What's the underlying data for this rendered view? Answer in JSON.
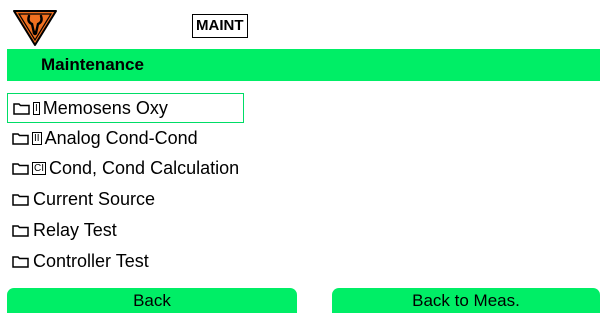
{
  "header": {
    "maint_tag": "MAINT",
    "icon": "maintenance-wrench-warning-icon"
  },
  "title": "Maintenance",
  "menu": {
    "items": [
      {
        "label": "Memosens Oxy",
        "channel": "I",
        "selected": true
      },
      {
        "label": "Analog Cond-Cond",
        "channel": "II",
        "selected": false
      },
      {
        "label": "Cond, Cond Calculation",
        "channel": "CI",
        "selected": false
      },
      {
        "label": "Current Source",
        "channel": "",
        "selected": false
      },
      {
        "label": "Relay Test",
        "channel": "",
        "selected": false
      },
      {
        "label": "Controller Test",
        "channel": "",
        "selected": false
      }
    ]
  },
  "softkeys": {
    "left": "Back",
    "right": "Back to Meas."
  },
  "colors": {
    "accent": "#00ee66",
    "warning": "#f07020"
  }
}
